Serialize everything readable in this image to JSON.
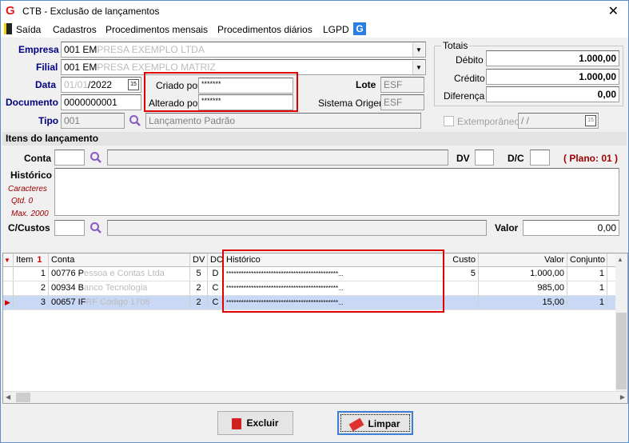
{
  "window": {
    "title": "CTB - Exclusão de lançamentos",
    "close_glyph": "✕"
  },
  "menu": {
    "saida": "Saída",
    "cadastros": "Cadastros",
    "proc_mensais": "Procedimentos mensais",
    "proc_diarios": "Procedimentos diários",
    "lgpd": "LGPD"
  },
  "header": {
    "empresa_label": "Empresa",
    "empresa_value": "001 EM",
    "empresa_blur": "PRESA EXEMPLO LTDA",
    "filial_label": "Filial",
    "filial_value": "001 EM",
    "filial_blur": "PRESA EXEMPLO MATRIZ",
    "data_label": "Data",
    "data_value_blur": "01/01",
    "data_value": "/2022",
    "documento_label": "Documento",
    "documento_value": "0000000001",
    "tipo_label": "Tipo",
    "tipo_value": "001",
    "tipo_desc": "Lançamento Padrão",
    "criado_label": "Criado por",
    "criado_value": "*******",
    "alterado_label": "Alterado por",
    "alterado_value": "*******",
    "lote_label": "Lote",
    "lote_value": "ESF",
    "sistema_label": "Sistema Origem",
    "sistema_value": "ESF",
    "extemporaneo_label": "Extemporâneo",
    "extemporaneo_date": " /  /"
  },
  "totais": {
    "caption": "Totais",
    "debito_label": "Débito",
    "debito_value": "1.000,00",
    "credito_label": "Crédito",
    "credito_value": "1.000,00",
    "diferenca_label": "Diferença",
    "diferenca_value": "0,00"
  },
  "itens": {
    "section_title": "Itens do lançamento",
    "conta_label": "Conta",
    "dv_label": "DV",
    "dc_label": "D/C",
    "plano": "( Plano: 01 )",
    "historico_label": "Histórico",
    "caracteres": "Caracteres",
    "qtd": "Qtd. 0",
    "max": "Max. 2000",
    "ccustos_label": "C/Custos",
    "valor_label": "Valor",
    "valor_value": "0,00"
  },
  "grid": {
    "columns": [
      "Item",
      "Conta",
      "DV",
      "DC",
      "Histórico",
      "Custo",
      "Valor",
      "Conjunto"
    ],
    "sort_indicator": "1",
    "rows": [
      {
        "item": "1",
        "conta": "00776 P",
        "conta_blur": "essoa e Contas Ltda",
        "dv": "5",
        "dc": "D",
        "historico": "*********************************************...",
        "custo": "5",
        "valor": "1.000,00",
        "conjunto": "1"
      },
      {
        "item": "2",
        "conta": "00934 B",
        "conta_blur": "anco Tecnologia",
        "dv": "2",
        "dc": "C",
        "historico": "*********************************************...",
        "custo": "",
        "valor": "985,00",
        "conjunto": "1"
      },
      {
        "item": "3",
        "conta": "00657 IF",
        "conta_blur": "RF Código 1708",
        "dv": "2",
        "dc": "C",
        "historico": "*********************************************...",
        "custo": "",
        "valor": "15,00",
        "conjunto": "1"
      }
    ]
  },
  "buttons": {
    "excluir": "Excluir",
    "limpar": "Limpar"
  },
  "colors": {
    "label_blue": "#000080",
    "highlight_red": "#e00000",
    "plano_red": "#a00000",
    "selected_row": "#c9d9f5"
  }
}
